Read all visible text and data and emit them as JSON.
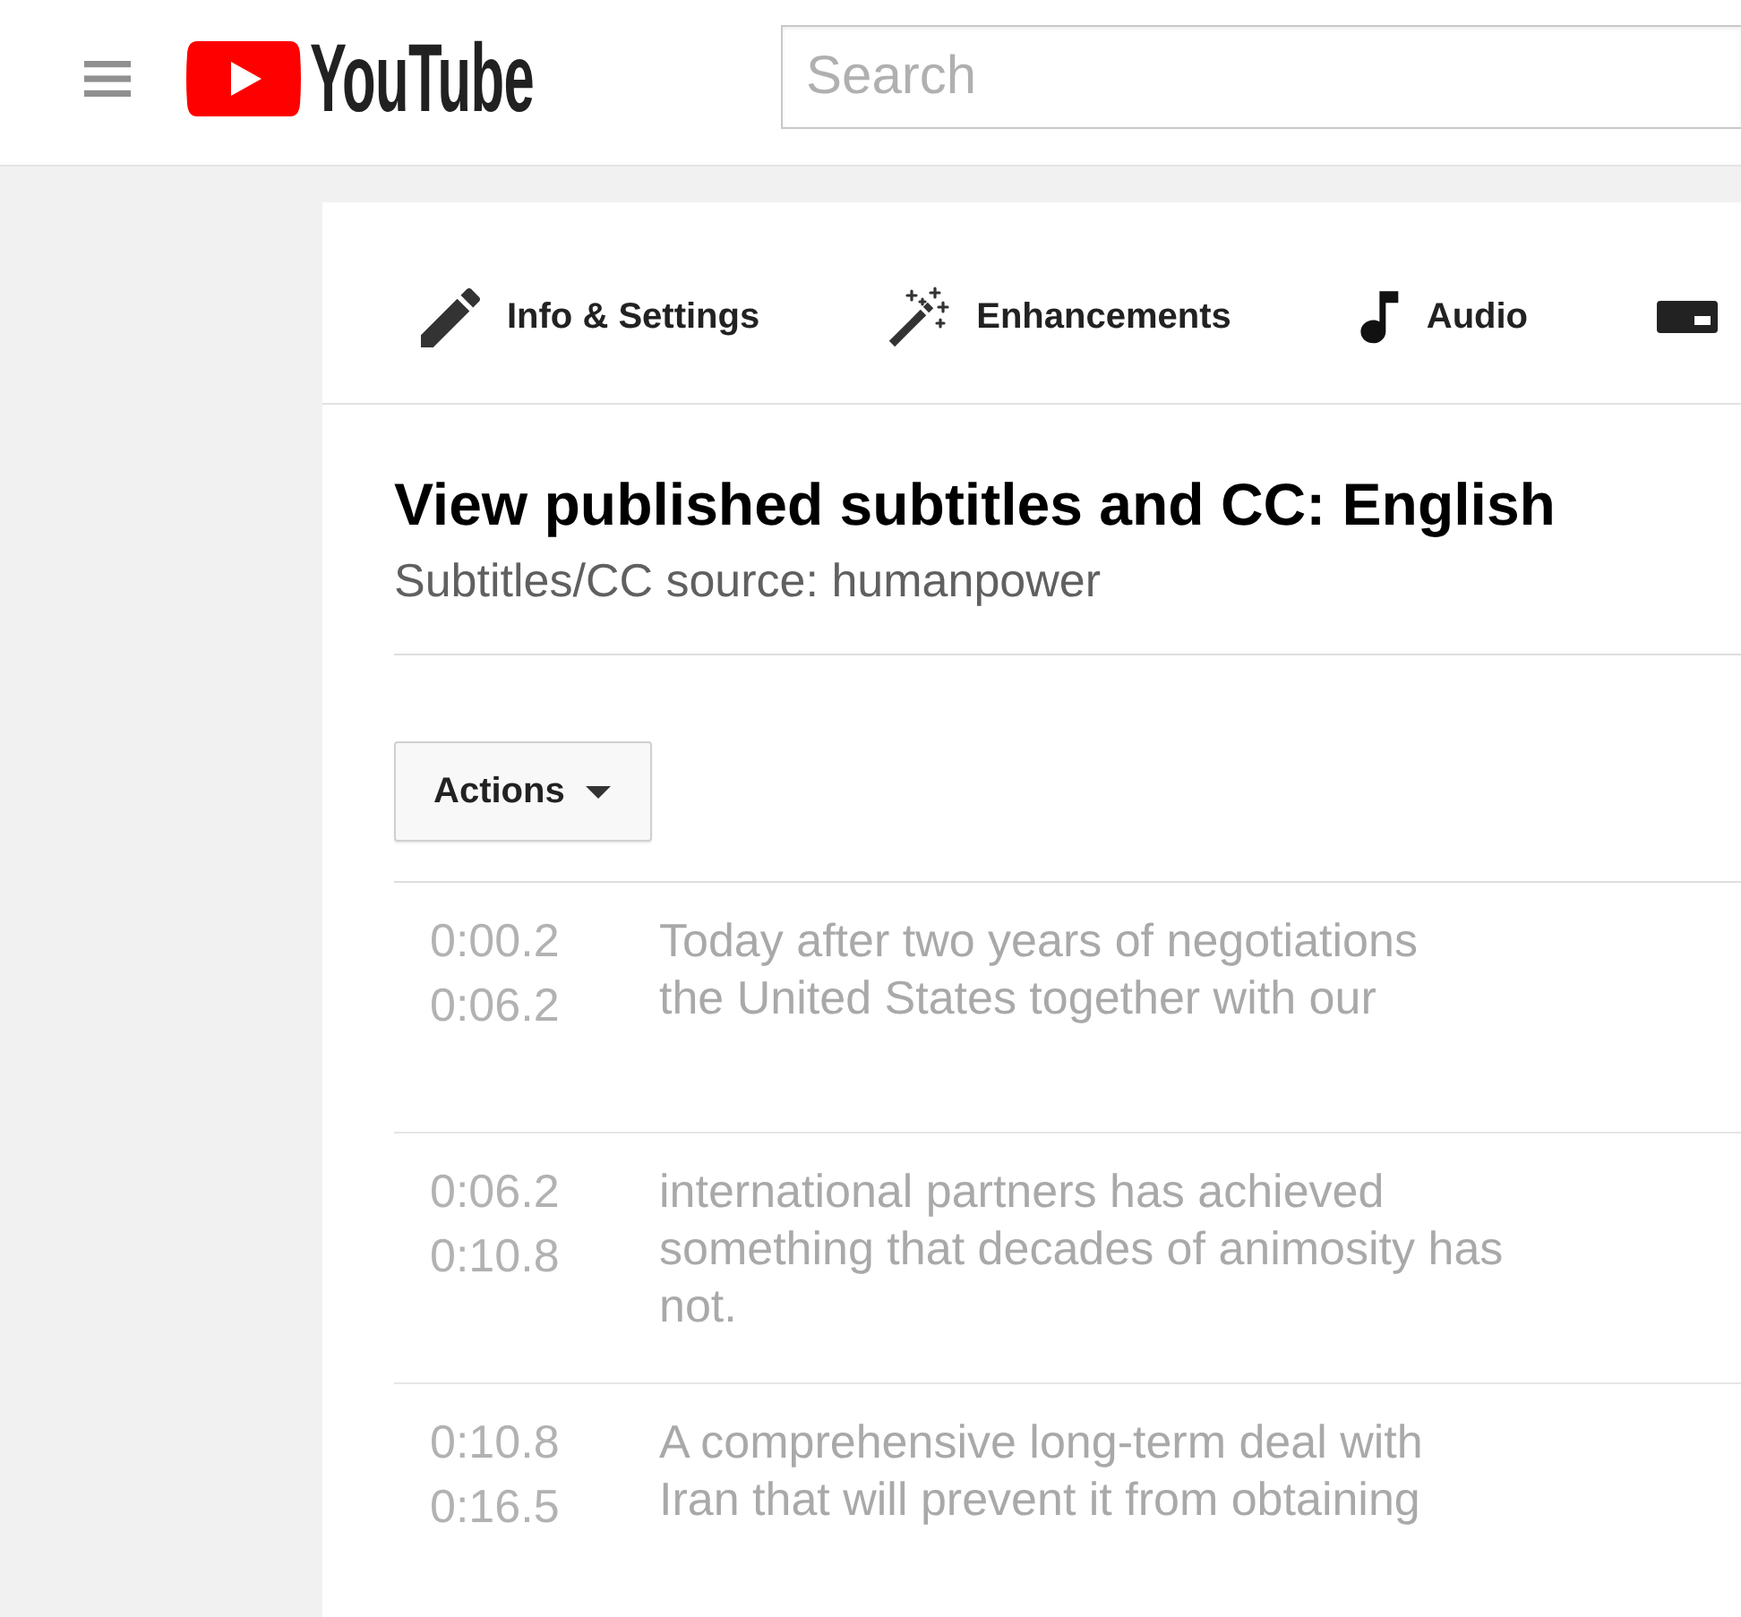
{
  "header": {
    "logo_text": "YouTube",
    "search": {
      "placeholder": "Search"
    }
  },
  "tabs": [
    {
      "label": "Info & Settings"
    },
    {
      "label": "Enhancements"
    },
    {
      "label": "Audio"
    }
  ],
  "panel": {
    "title": "View published subtitles and CC: English",
    "source": "Subtitles/CC source: humanpower",
    "actions_button": {
      "label": "Actions"
    }
  },
  "captions": [
    {
      "start": "0:00.2",
      "end": "0:06.2",
      "text": "Today after two years of negotiations\nthe United States together with our"
    },
    {
      "start": "0:06.2",
      "end": "0:10.8",
      "text": "international partners has achieved\nsomething that decades of animosity has not."
    },
    {
      "start": "0:10.8",
      "end": "0:16.5",
      "text": "A comprehensive long-term deal with\nIran that will prevent it from obtaining"
    }
  ]
}
